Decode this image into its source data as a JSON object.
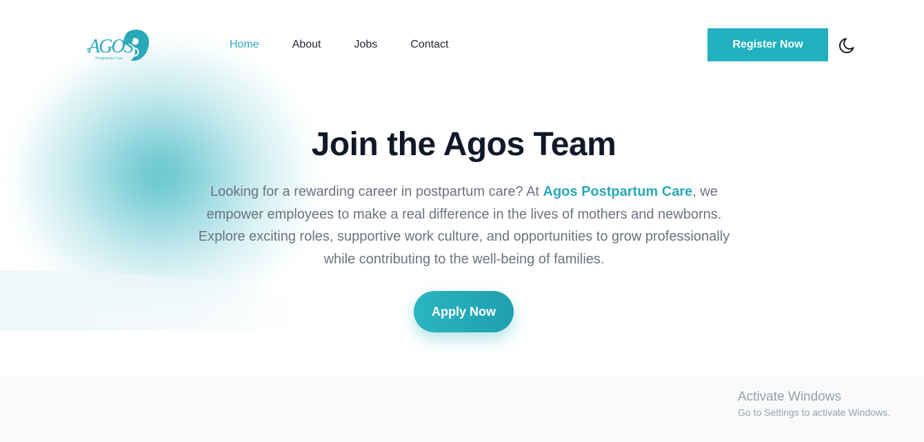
{
  "brand": {
    "logo_text": "AGOS",
    "logo_subtext": "Postpartum Care",
    "accent_color": "#22b1be"
  },
  "nav": {
    "items": [
      {
        "label": "Home",
        "active": true
      },
      {
        "label": "About",
        "active": false
      },
      {
        "label": "Jobs",
        "active": false
      },
      {
        "label": "Contact",
        "active": false
      }
    ]
  },
  "header": {
    "register_label": "Register Now",
    "theme_icon": "moon-icon"
  },
  "hero": {
    "title": "Join the Agos Team",
    "text_before": "Looking for a rewarding career in postpartum care? At ",
    "brand_highlight": "Agos Postpartum Care",
    "text_after": ", we empower employees to make a real difference in the lives of mothers and newborns. Explore exciting roles, supportive work culture, and opportunities to grow professionally while contributing to the well-being of families.",
    "apply_label": "Apply Now"
  },
  "watermark": {
    "title": "Activate Windows",
    "subtitle": "Go to Settings to activate Windows."
  }
}
